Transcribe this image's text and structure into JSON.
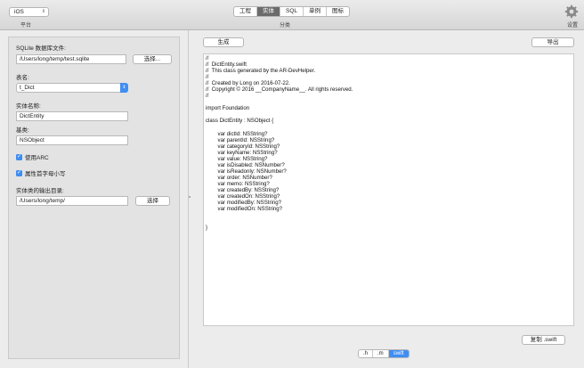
{
  "toolbar": {
    "platform_value": "iOS",
    "platform_caption": "平台",
    "segments": [
      {
        "label": "工程",
        "active": false
      },
      {
        "label": "实体",
        "active": true
      },
      {
        "label": "SQL",
        "active": false
      },
      {
        "label": "单例",
        "active": false
      },
      {
        "label": "图标",
        "active": false
      }
    ],
    "segment_caption": "分类",
    "settings_caption": "设置",
    "settings_icon": "gear-icon"
  },
  "left": {
    "db_label": "SQLite 数据库文件:",
    "db_path": "/Users/long/temp/test.sqlite",
    "choose_label": "选择...",
    "table_label": "表名:",
    "table_value": "t_Dict",
    "entity_label": "实体名称:",
    "entity_value": "DictEntity",
    "base_label": "基类:",
    "base_value": "NSObject",
    "use_arc_label": "使用ARC",
    "use_arc_checked": true,
    "lower_first_label": "属性首字母小写",
    "lower_first_checked": true,
    "output_label": "实体类的输出目录:",
    "output_path": "/Users/long/temp/",
    "output_choose_label": "选择"
  },
  "right": {
    "generate_label": "生成",
    "export_label": "导出",
    "copy_label": "复制 .swift",
    "extensions": [
      {
        "label": ".h",
        "active": false
      },
      {
        "label": ".m",
        "active": false
      },
      {
        "label": "swift",
        "active": true
      }
    ],
    "code_lines": [
      "//",
      "//  DictEntity.swift",
      "//  This class generated by the AR-DevHelper.",
      "//",
      "//  Created by Long on 2016-07-22.",
      "//  Copyright © 2016 __CompanyName__. All rights reserved.",
      "//",
      "",
      "import Foundation",
      "",
      "class DictEntity : NSObject {",
      "",
      "        var dictId: NSString?",
      "        var parentId: NSString?",
      "        var categoryId: NSString?",
      "        var keyName: NSString?",
      "        var value: NSString?",
      "        var isDisabled: NSNumber?",
      "        var isReadonly: NSNumber?",
      "        var order: NSNumber?",
      "        var memo: NSString?",
      "        var createdBy: NSString?",
      "        var createdOn: NSString?",
      "        var modifiedBy: NSString?",
      "        var modifiedOn: NSString?",
      "",
      "",
      "}"
    ]
  }
}
